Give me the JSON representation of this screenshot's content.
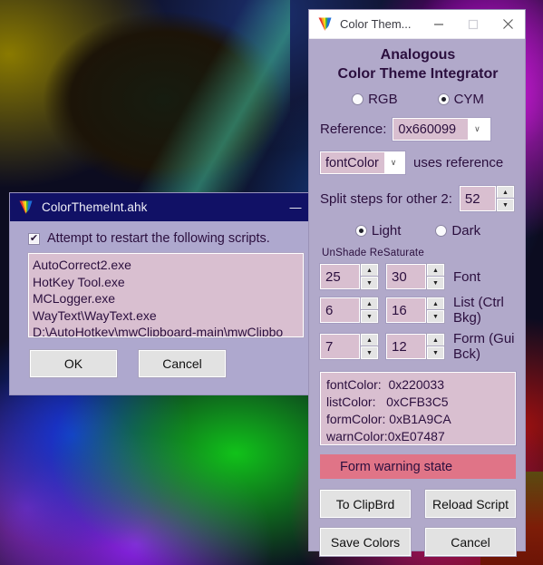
{
  "desktop": {
    "wallpaper": "abstract-color-blend"
  },
  "left_window": {
    "title": "ColorThemeInt.ahk",
    "icon": "ahk-icon",
    "minimize_label": "—",
    "checkbox": {
      "checked": true,
      "mark": "✔",
      "label": "Attempt to restart the following scripts."
    },
    "script_list": [
      "AutoCorrect2.exe",
      "HotKey Tool.exe",
      "MCLogger.exe",
      "WayText\\WayText.exe",
      "D:\\AutoHotkey\\mwClipboard-main\\mwClipbo"
    ],
    "buttons": {
      "ok": "OK",
      "cancel": "Cancel"
    }
  },
  "right_window": {
    "title": "Color Them...",
    "icon": "ahk-icon",
    "titlebar_buttons": {
      "minimize": "—",
      "maximize": "❐",
      "close": "✕"
    },
    "heading_line1": "Analogous",
    "heading_line2": "Color Theme Integrator",
    "color_mode": {
      "options": [
        {
          "label": "RGB",
          "selected": false
        },
        {
          "label": "CYM",
          "selected": true
        }
      ]
    },
    "reference": {
      "label": "Reference:",
      "value": "0x660099",
      "arrow": "∨"
    },
    "uses_reference": {
      "value": "fontColor",
      "arrow": "∨",
      "label": "uses reference"
    },
    "split_steps": {
      "label": "Split steps for other 2:",
      "value": "52",
      "up": "▲",
      "down": "▼"
    },
    "theme_mode": {
      "options": [
        {
          "label": "Light",
          "selected": true
        },
        {
          "label": "Dark",
          "selected": false
        }
      ]
    },
    "columns_header": "UnShade ReSaturate",
    "adjust_rows": [
      {
        "unshade": "25",
        "resaturate": "30",
        "caption": "Font"
      },
      {
        "unshade": "6",
        "resaturate": "16",
        "caption": "List (Ctrl Bkg)"
      },
      {
        "unshade": "7",
        "resaturate": "12",
        "caption": "Form (Gui Bck)"
      }
    ],
    "spinner_glyphs": {
      "up": "▲",
      "down": "▼"
    },
    "color_results": [
      "fontColor:  0x220033",
      "listColor:   0xCFB3C5",
      "formColor: 0xB1A9CA",
      "warnColor:0xE07487"
    ],
    "warning_bar": {
      "text": "Form warning state",
      "color": "#E07487"
    },
    "buttons": {
      "to_clipbrd": "To ClipBrd",
      "reload_script": "Reload Script",
      "save_colors": "Save Colors",
      "cancel": "Cancel"
    }
  },
  "colors": {
    "form_bg": "#B1A9CA",
    "list_bg": "#CFB3C5",
    "font_color": "#220033",
    "warn_color": "#E07487",
    "left_titlebar": "#111166"
  }
}
